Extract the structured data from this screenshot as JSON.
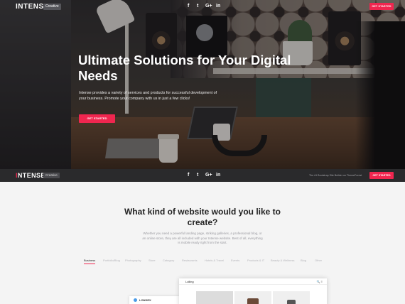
{
  "nav": {
    "logo": "INTENSE",
    "logo_tag": "Creative",
    "social": [
      "f",
      "t",
      "G+",
      "in"
    ],
    "cta": "GET STARTED"
  },
  "hero": {
    "title": "Ultimate Solutions for Your Digital Needs",
    "subtitle": "Intense provides a variety of services and products for successful development of your business. Promote your company with us in just a few clicks!",
    "button": "GET STARTED"
  },
  "sticky": {
    "logo_prefix": "I",
    "logo_rest": "NTENSE",
    "logo_tag": "Creative",
    "social": [
      "f",
      "t",
      "G+",
      "in"
    ],
    "text": "The #1 Bootstrap Site Builder on ThemeForest",
    "cta": "GET STARTED"
  },
  "section": {
    "title": "What kind of website would you like to create?",
    "description": "Whether you need a powerful landing page, striking galleries, a professional blog, or an online store, they are all included with your Intense website. Best of all, everything is mobile ready right from the start.",
    "tabs": [
      "Business",
      "Portfolio/Blog",
      "Photography",
      "Store",
      "Category",
      "Restaurants",
      "Hotels & Travel",
      "Events",
      "Products & IT",
      "Beauty & Wellness",
      "Blog",
      "Other"
    ],
    "active_tab": "Business"
  },
  "previews": {
    "back_logo": "LONDEX",
    "front_logo": "Lolling",
    "front_icons": "🔍 ≡"
  },
  "colors": {
    "accent": "#f0264f",
    "dark_bar": "#2a2a2c",
    "page_bg": "#f4f4f4"
  }
}
